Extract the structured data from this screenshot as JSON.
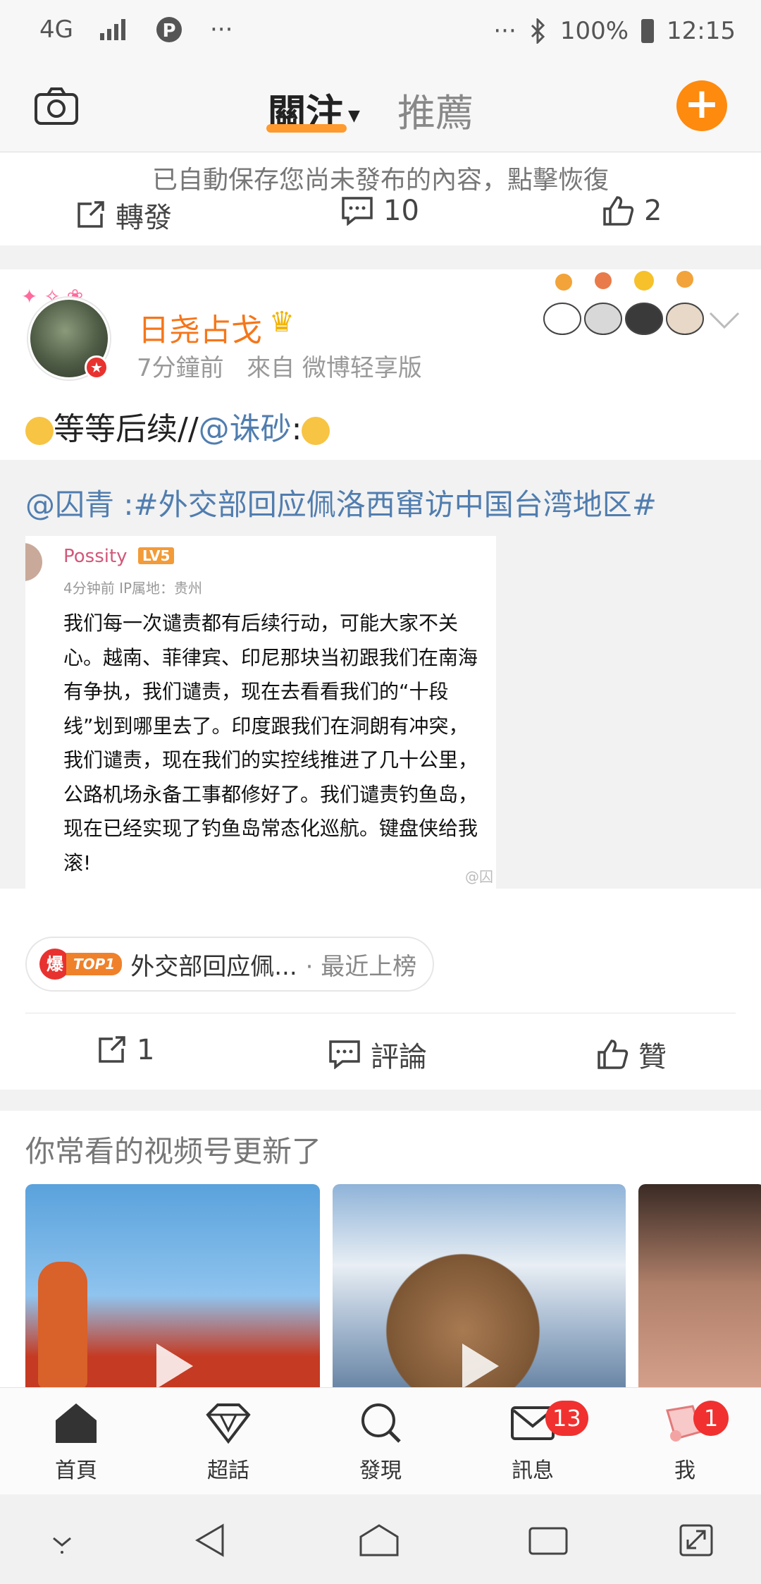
{
  "status_bar": {
    "network": "4G",
    "battery": "100%",
    "time": "12:15",
    "dots": "···"
  },
  "top_nav": {
    "tab_follow": "關注",
    "tab_recommend": "推薦",
    "accent_color": "#ff9a2e"
  },
  "prev_card": {
    "draft_notice": "已自動保存您尚未發布的內容，點擊恢復",
    "repost_label": "轉發",
    "comment_count": "10",
    "like_count": "2"
  },
  "post": {
    "username": "日尧占戈",
    "time": "7分鐘前",
    "source": "來自 微博轻享版",
    "text_prefix": "等等后续//",
    "mention": "@诛砂",
    "text_suffix": ":",
    "repost": {
      "text": "@囚青 :#外交部回应佩洛西窜访中国台湾地区#",
      "image": {
        "name": "Possity",
        "level": "LV5",
        "meta": "4分钟前  IP属地：贵州",
        "body": "我们每一次谴责都有后续行动，可能大家不关心。越南、菲律宾、印尼那块当初跟我们在南海有争执，我们谴责，现在去看看我们的“十段线”划到哪里去了。印度跟我们在洞朗有冲突，我们谴责，现在我们的实控线推进了几十公里，公路机场永备工事都修好了。我们谴责钓鱼岛，现在已经实现了钓鱼岛常态化巡航。键盘侠给我滚!",
        "watermark": "@囚"
      }
    },
    "hot_badge_char": "爆",
    "hot_badge_rank": "TOP1",
    "hot_topic": "外交部回应佩...",
    "hot_suffix": "· 最近上榜",
    "repost_count": "1",
    "comment_label": "評論",
    "like_label": "贊"
  },
  "video_section": {
    "title": "你常看的视频号更新了"
  },
  "tab_bar": {
    "home": "首頁",
    "super_topic": "超話",
    "discover": "發現",
    "messages": "訊息",
    "messages_badge": "13",
    "me": "我",
    "me_badge": "1"
  }
}
